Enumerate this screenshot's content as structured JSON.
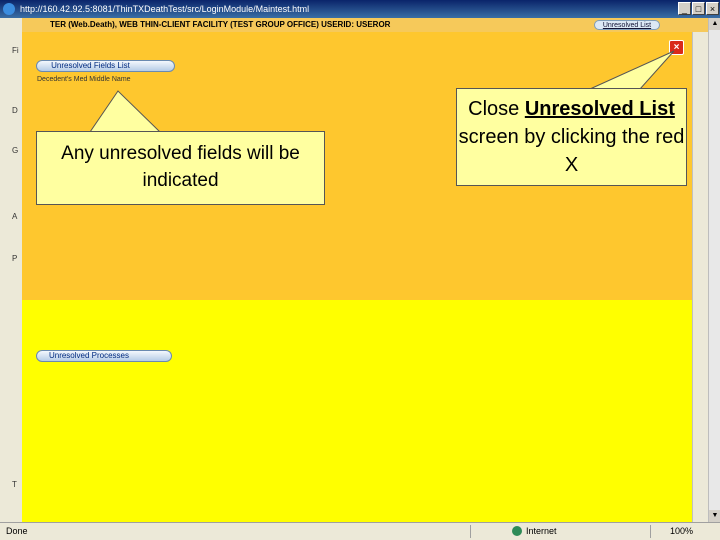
{
  "window": {
    "title": "http://160.42.92.5:8081/ThinTXDeathTest/src/LoginModule/Maintest.html"
  },
  "header": {
    "text": "TER (Web.Death), WEB THIN-CLIENT FACILITY (TEST GROUP OFFICE) USERID: USEROR",
    "link": "Unresolved List"
  },
  "left_fragments": [
    "Fi",
    "D",
    "G",
    "A",
    "P",
    "T"
  ],
  "panel": {
    "fields_tab": "Unresolved Fields List",
    "field_label": "Decedent's Med Middle Name",
    "processes_tab": "Unresolved Processes",
    "close": "×"
  },
  "callouts": {
    "left": "Any unresolved fields will be indicated",
    "right_pre": "Close ",
    "right_emph": "Unresolved List",
    "right_post": " screen by clicking the red X"
  },
  "status": {
    "left": "Done",
    "zone": "Internet",
    "zoom": "100%"
  },
  "colors": {
    "orange_panel": "#fec72e",
    "yellow_panel": "#ffff00",
    "callout_bg": "#ffffa0",
    "close_red": "#d92a1a"
  }
}
